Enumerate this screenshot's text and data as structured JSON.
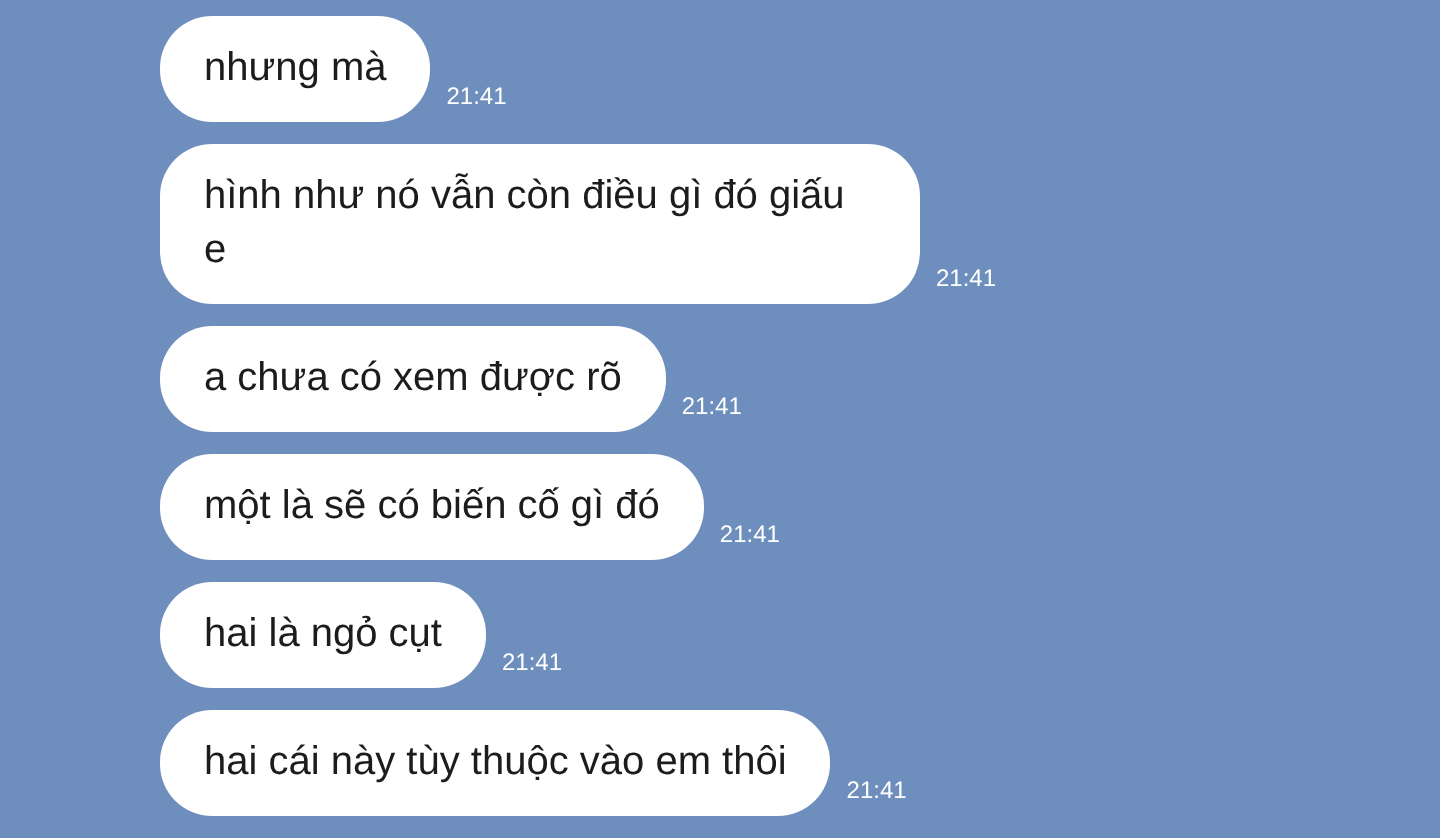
{
  "messages": [
    {
      "text": "nhưng mà",
      "time": "21:41"
    },
    {
      "text": "hình như nó vẫn còn điều gì đó giấu e",
      "time": "21:41"
    },
    {
      "text": "a chưa có xem được rõ",
      "time": "21:41"
    },
    {
      "text": "một là sẽ có biến cố gì đó",
      "time": "21:41"
    },
    {
      "text": "hai là ngỏ cụt",
      "time": "21:41"
    },
    {
      "text": "hai cái này tùy thuộc vào em thôi",
      "time": "21:41"
    }
  ]
}
